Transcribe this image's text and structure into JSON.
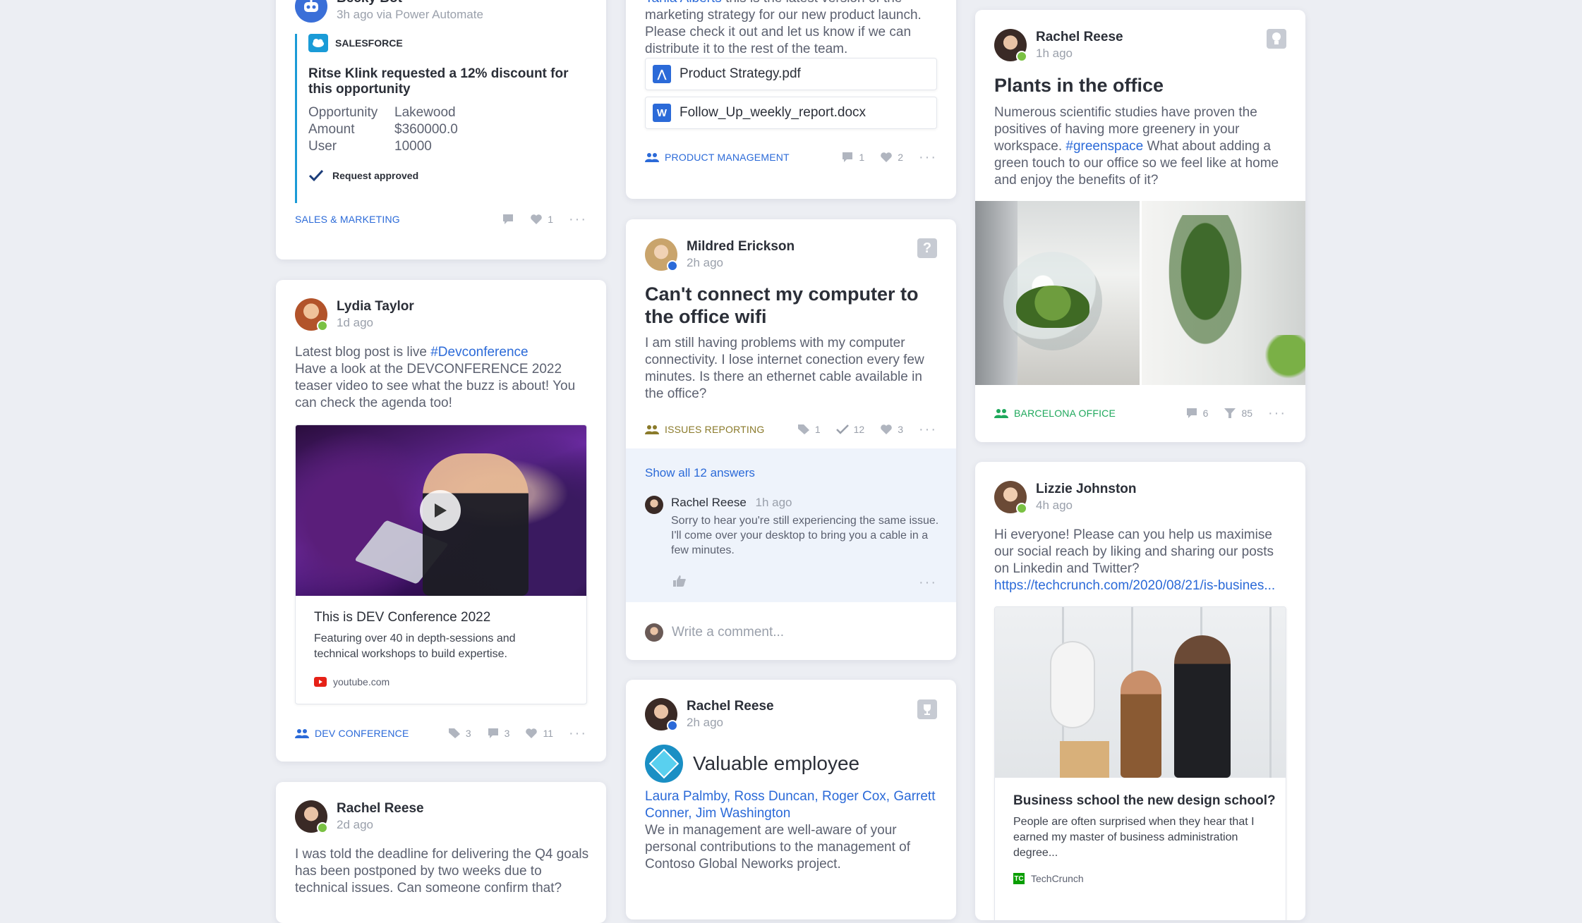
{
  "colors": {
    "background": "#eceef3",
    "link": "#2b6ad8",
    "online": "#7ac143",
    "busy": "#2b6ad8",
    "tag_blue": "#2b6ad8",
    "tag_green": "#1fa85c",
    "tag_olive": "#8a7a2a"
  },
  "bot_card": {
    "author": "Becky Bot",
    "meta": "3h ago via Power Automate",
    "source": "SALESFORCE",
    "headline": "Ritse Klink requested a 12% discount for this opportunity",
    "fields": [
      {
        "label": "Opportunity",
        "value": "Lakewood"
      },
      {
        "label": "Amount",
        "value": "$360000.0"
      },
      {
        "label": "User",
        "value": "10000"
      }
    ],
    "status": "Request approved",
    "tag": "SALES & MARKETING",
    "likes": "1"
  },
  "lydia_card": {
    "author": "Lydia Taylor",
    "meta": "1d ago",
    "text_prefix": "Latest blog post is live ",
    "hashtag": "#Devconference",
    "text": "Have a look at the DEVCONFERENCE 2022 teaser video to see what the buzz is about! You can check the agenda too!",
    "preview_title": "This is DEV Conference 2022",
    "preview_desc": "Featuring over 40 in depth-sessions and technical workshops to build expertise.",
    "preview_source": "youtube.com",
    "tag": "DEV CONFERENCE",
    "tags_count": "3",
    "comments": "3",
    "likes": "11"
  },
  "rachel_short_card": {
    "author": "Rachel Reese",
    "meta": "2d ago",
    "text": "I was told the deadline for delivering the Q4 goals has been postponed by two weeks due to technical issues. Can someone confirm that?"
  },
  "strategy_card": {
    "mention": "Tania Alberts",
    "text_after_mention": " this is the latest version of the marketing strategy for our new product launch. Please check it out and let us know if we can distribute it to the rest of the team.",
    "files": [
      {
        "name": "Product Strategy.pdf",
        "type_icon": "pdf-icon",
        "letter": "A"
      },
      {
        "name": "Follow_Up_weekly_report.docx",
        "type_icon": "word-icon",
        "letter": "W"
      }
    ],
    "tag": "PRODUCT MANAGEMENT",
    "comments": "1",
    "likes": "2"
  },
  "question_card": {
    "author": "Mildred Erickson",
    "meta": "2h ago",
    "title": "Can't connect my computer to the office wifi",
    "text": "I am still having problems with my computer connectivity. I lose internet conection every few minutes. Is there an ethernet cable available in the office?",
    "tag": "ISSUES REPORTING",
    "tags_count": "1",
    "answers_count": "12",
    "likes": "3",
    "show_all": "Show all 12 answers",
    "reply_author": "Rachel Reese",
    "reply_time": "1h ago",
    "reply_text": "Sorry to hear you're still experiencing the same issue.  I'll come over your desktop to bring you a cable  in a few minutes.",
    "comment_placeholder": "Write a comment..."
  },
  "praise_card": {
    "author": "Rachel Reese",
    "meta": "2h ago",
    "badge_title": "Valuable employee",
    "people": "Laura Palmby, Ross Duncan, Roger Cox, Garrett Conner, Jim Washington",
    "text": "We in management are well-aware of your personal contributions to the management of Contoso Global Neworks project."
  },
  "plants_card": {
    "author": "Rachel Reese",
    "meta": "1h ago",
    "title": "Plants in the office",
    "text_before": "Numerous scientific studies have proven the positives of having more greenery in your workspace. ",
    "hashtag": "#greenspace",
    "text_after": " What about adding a green touch to our office so we feel like at home and enjoy the benefits of it?",
    "tag": "BARCELONA OFFICE",
    "comments": "6",
    "votes": "85"
  },
  "lizzie_card": {
    "author": "Lizzie Johnston",
    "meta": "4h ago",
    "text": "Hi everyone! Please can you help us maximise our social reach by liking and sharing our posts on Linkedin and Twitter?",
    "url": "https://techcrunch.com/2020/08/21/is-busines...",
    "preview_title": "Business school the new design school?",
    "preview_desc": "People are often surprised when they hear that I earned my master of business administration degree...",
    "preview_source": "TechCrunch"
  }
}
